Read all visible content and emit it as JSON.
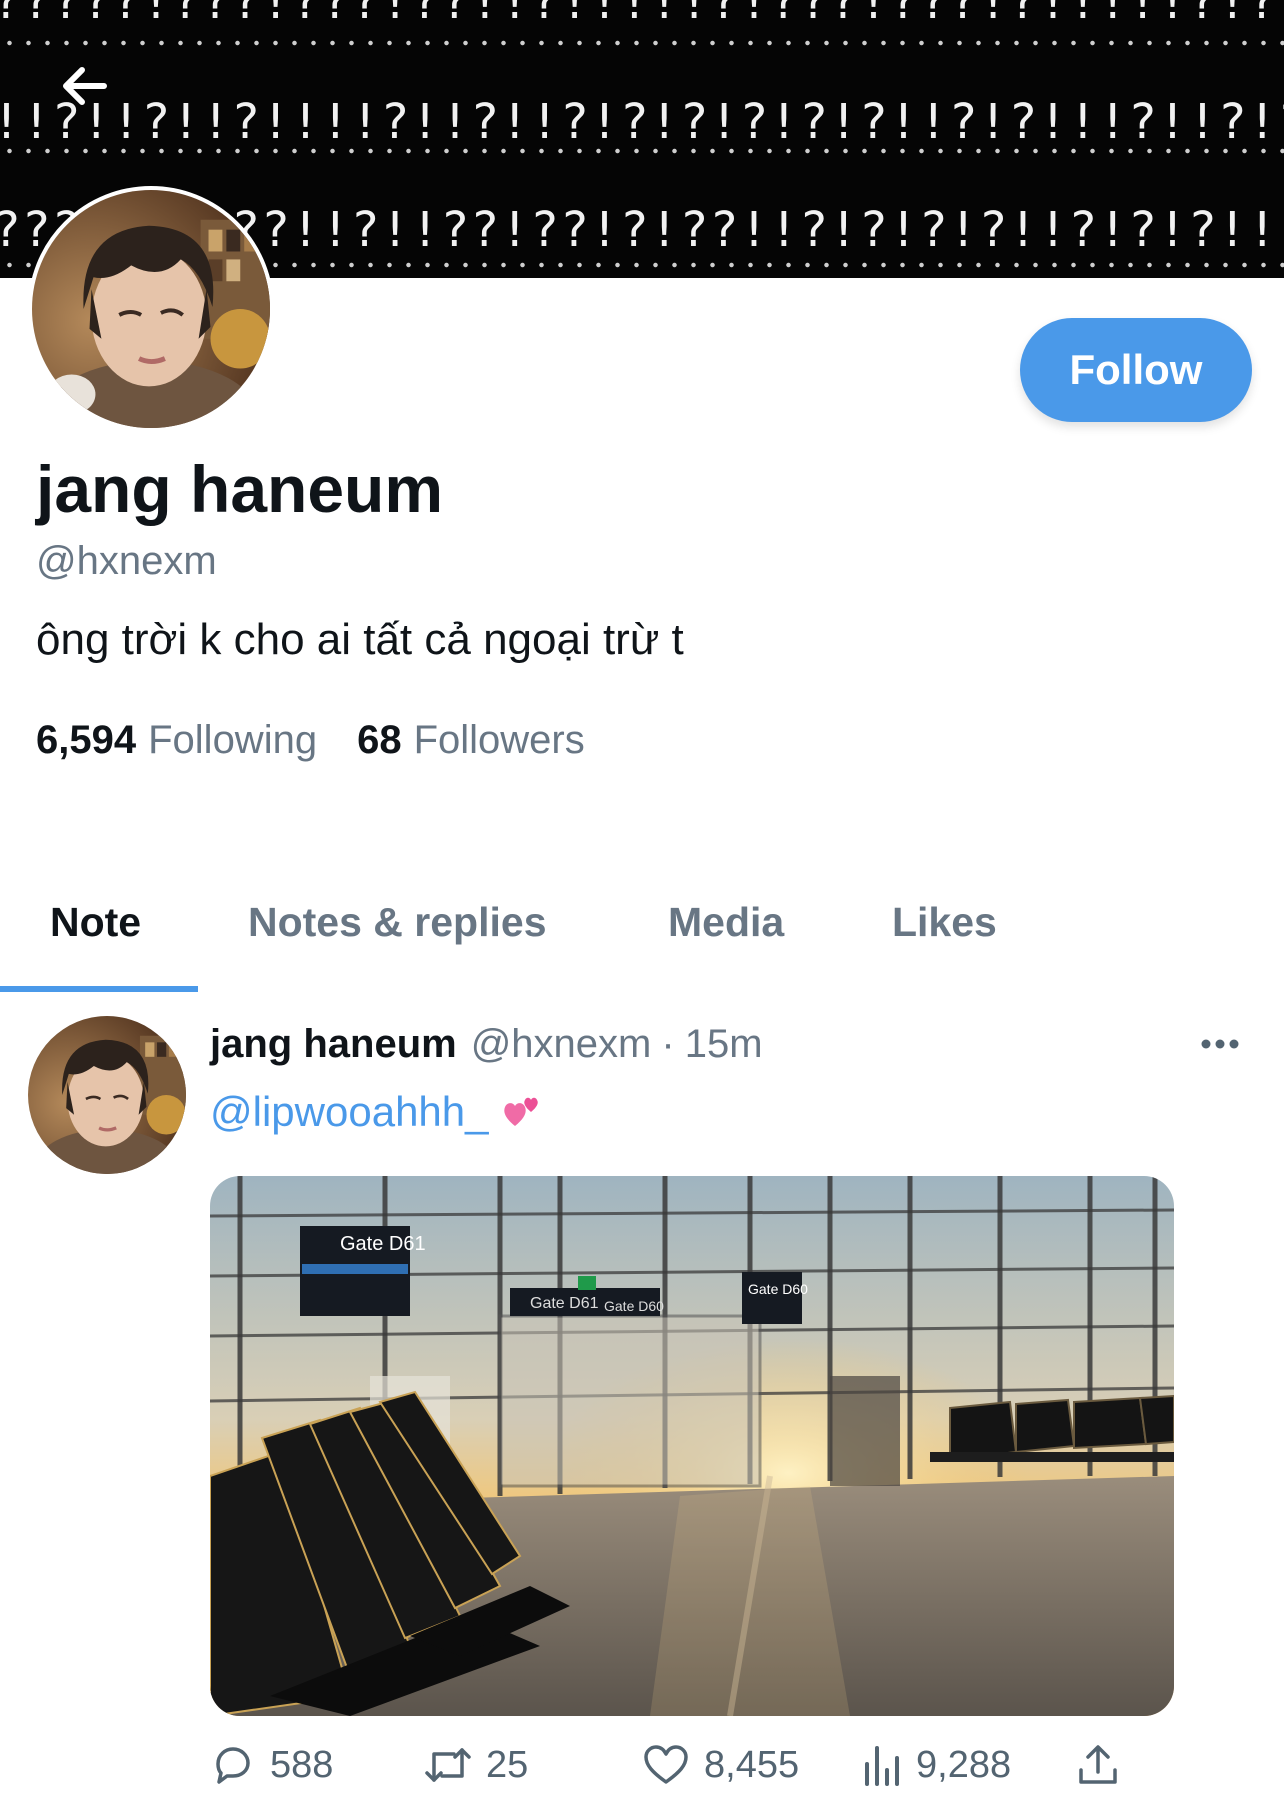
{
  "banner": {
    "lines": [
      "?????!???!???!??!!?!!!!!?!???!???!?!!!!!?!??!?!",
      "!!?!!?!!?!!!!?!!?!!?!?!?!?!?!?!!?!?!!!?!!?!?!",
      "????!??!??!!?!!??!??!?!??!!?!?!?!?!!?!?!?!!!!"
    ]
  },
  "profile": {
    "display_name": "jang haneum",
    "handle": "@hxnexm",
    "bio": "ông trời k cho ai tất cả ngoại trừ t",
    "following_count": "6,594",
    "following_label": "Following",
    "followers_count": "68",
    "followers_label": "Followers",
    "follow_label": "Follow"
  },
  "tabs": [
    {
      "label": "Note",
      "active": true
    },
    {
      "label": "Notes & replies",
      "active": false
    },
    {
      "label": "Media",
      "active": false
    },
    {
      "label": "Likes",
      "active": false
    }
  ],
  "tweet": {
    "author_name": "jang haneum",
    "author_handle": "@hxnexm",
    "separator": "·",
    "time": "15m",
    "mention": "@lipwooahhh_",
    "emoji": "💕",
    "media": {
      "signs": [
        "Gate D61",
        "Gate D61",
        "Gate D60",
        "Gate D60"
      ]
    },
    "counts": {
      "replies": "588",
      "retweets": "25",
      "likes": "8,455",
      "views": "9,288"
    }
  },
  "icons": {
    "back": "arrow-left-icon",
    "more": "more-dots-icon",
    "reply": "reply-bubble-icon",
    "retweet": "retweet-icon",
    "like": "heart-icon",
    "views": "views-bar-icon",
    "share": "share-icon"
  },
  "colors": {
    "accent": "#4a99e9",
    "text": "#0f1419",
    "secondary": "#687684",
    "banner_bg": "#050505"
  }
}
